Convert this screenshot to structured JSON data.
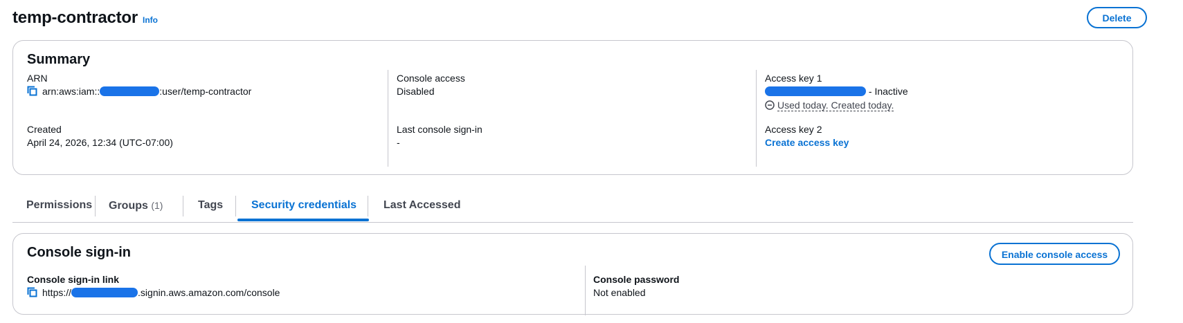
{
  "header": {
    "title": "temp-contractor",
    "info_label": "Info",
    "delete_label": "Delete"
  },
  "summary": {
    "title": "Summary",
    "arn": {
      "label": "ARN",
      "prefix": "arn:aws:iam::",
      "suffix": ":user/temp-contractor"
    },
    "created": {
      "label": "Created",
      "value": "April 24, 2026, 12:34 (UTC-07:00)"
    },
    "console_access": {
      "label": "Console access",
      "value": "Disabled"
    },
    "last_console_signin": {
      "label": "Last console sign-in",
      "value": "-"
    },
    "access_key_1": {
      "label": "Access key 1",
      "status": " - Inactive",
      "usage": "Used today. Created today."
    },
    "access_key_2": {
      "label": "Access key 2",
      "action": "Create access key"
    }
  },
  "tabs": [
    {
      "label": "Permissions",
      "count": ""
    },
    {
      "label": "Groups",
      "count": "(1)"
    },
    {
      "label": "Tags",
      "count": ""
    },
    {
      "label": "Security credentials",
      "count": ""
    },
    {
      "label": "Last Accessed",
      "count": ""
    }
  ],
  "active_tab": "Security credentials",
  "console_signin": {
    "title": "Console sign-in",
    "enable_label": "Enable console access",
    "link_label": "Console sign-in link",
    "link_prefix": "https://",
    "link_suffix": ".signin.aws.amazon.com/console",
    "password_label": "Console password",
    "password_value": "Not enabled"
  },
  "colors": {
    "accent": "#0972d3",
    "border": "#c6c6cd",
    "redaction": "#1a73e8"
  },
  "icons": [
    "copy-icon",
    "status-negative-icon"
  ]
}
